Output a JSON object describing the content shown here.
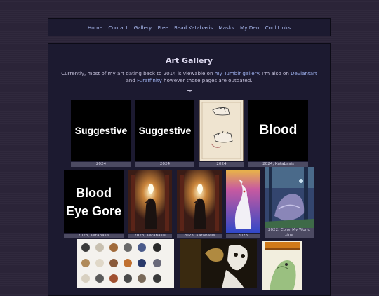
{
  "nav": {
    "links": [
      "Home",
      "Contact",
      "Gallery",
      "Free",
      "Read Katabasis",
      "Masks",
      "My Den",
      "Cool Links"
    ],
    "separator": "."
  },
  "gallery": {
    "title": "Art Gallery",
    "intro": {
      "part1": "Currently, most of my art dating back to 2014 is viewable on ",
      "link1": "my Tumblr gallery",
      "part2": ". I'm also on ",
      "link2": "Deviantart",
      "part3": " and ",
      "link3": "Furaffinity",
      "part4": " however those pages are outdated."
    },
    "divider": "~",
    "items": [
      {
        "thumb_text": [
          "Suggestive"
        ],
        "caption": "2024"
      },
      {
        "thumb_text": [
          "Suggestive"
        ],
        "caption": "2024"
      },
      {
        "thumb_text": [],
        "caption": "2024"
      },
      {
        "thumb_text": [
          "Blood"
        ],
        "caption": "2024, Katabasis"
      },
      {
        "thumb_text": [
          "Blood",
          "Eye Gore"
        ],
        "caption": "2023, Katabasis"
      },
      {
        "thumb_text": [],
        "caption": "2023, Katabasis"
      },
      {
        "thumb_text": [],
        "caption": "2023, Katabasis"
      },
      {
        "thumb_text": [],
        "caption": "2023"
      },
      {
        "thumb_text": [],
        "caption": "2022, Color My World zine"
      }
    ]
  },
  "colors": {
    "background": "#2b2438",
    "panel": "#1c1a30",
    "link": "#9fb2f0",
    "caption_bg": "#4c4a62"
  }
}
